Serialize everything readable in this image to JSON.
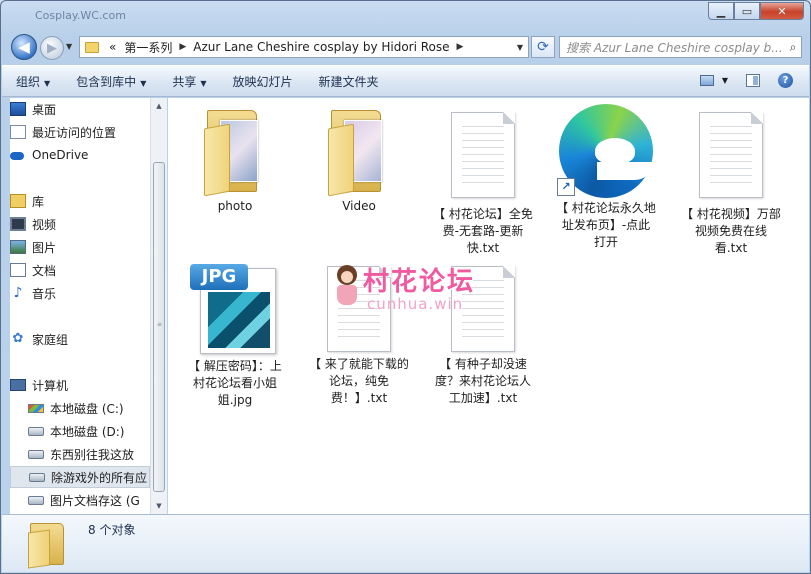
{
  "window": {
    "title": "Cosplay.WC.com"
  },
  "address": {
    "crumbs": [
      "第一系列",
      "Azur Lane Cheshire cosplay by Hidori Rose"
    ],
    "overflow": "«"
  },
  "search": {
    "placeholder": "搜索 Azur Lane Cheshire cosplay b..."
  },
  "toolbar": {
    "organize": "组织",
    "include": "包含到库中",
    "share": "共享",
    "slideshow": "放映幻灯片",
    "new_folder": "新建文件夹"
  },
  "nav": {
    "items": [
      {
        "label": "桌面",
        "icon": "desktop-icon"
      },
      {
        "label": "最近访问的位置",
        "icon": "recent-places-icon"
      },
      {
        "label": "OneDrive",
        "icon": "onedrive-icon"
      },
      {
        "label": "库",
        "icon": "library-icon"
      },
      {
        "label": "视频",
        "icon": "videos-icon"
      },
      {
        "label": "图片",
        "icon": "pictures-icon"
      },
      {
        "label": "文档",
        "icon": "documents-icon"
      },
      {
        "label": "音乐",
        "icon": "music-icon"
      },
      {
        "label": "家庭组",
        "icon": "homegroup-icon"
      },
      {
        "label": "计算机",
        "icon": "computer-icon"
      },
      {
        "label": "本地磁盘 (C:)",
        "icon": "drive-c-icon"
      },
      {
        "label": "本地磁盘 (D:)",
        "icon": "drive-icon"
      },
      {
        "label": "东西别往我这放",
        "icon": "drive-icon"
      },
      {
        "label": "除游戏外的所有应",
        "icon": "drive-icon"
      },
      {
        "label": "图片文档存这 (G",
        "icon": "drive-icon"
      }
    ]
  },
  "files": [
    {
      "name": "photo",
      "type": "folder"
    },
    {
      "name": "Video",
      "type": "folder"
    },
    {
      "name": "【 村花论坛】全免费-无套路-更新快.txt",
      "type": "txt"
    },
    {
      "name": "【 村花论坛永久地址发布页】-点此打开",
      "type": "shortcut"
    },
    {
      "name": "【 村花视频】万部视频免费在线看.txt",
      "type": "txt"
    },
    {
      "name": "【 解压密码】：上村花论坛看小姐姐.jpg",
      "type": "jpg"
    },
    {
      "name": "【 来了就能下载的论坛，纯免费！】.txt",
      "type": "txt"
    },
    {
      "name": "【 有种子却没速度？来村花论坛人工加速】.txt",
      "type": "txt"
    }
  ],
  "jpg_badge": "JPG",
  "watermark": {
    "brand": "村花论坛",
    "sub": "cunhua.win"
  },
  "status": {
    "count": "8 个对象"
  }
}
